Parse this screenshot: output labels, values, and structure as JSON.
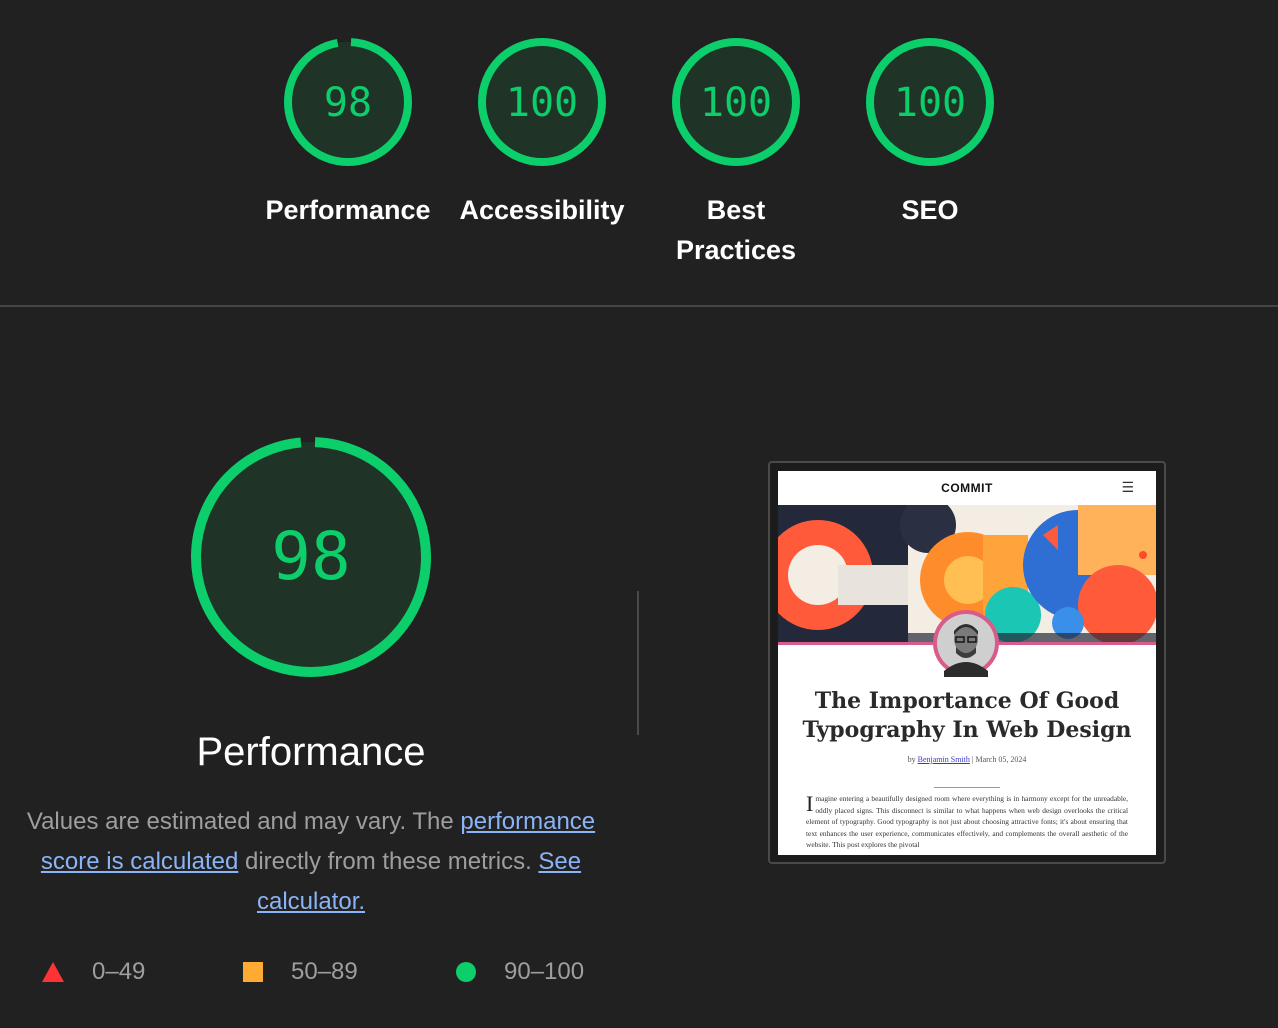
{
  "categories": [
    {
      "score": "98",
      "label": "Performance",
      "value": 0.98
    },
    {
      "score": "100",
      "label": "Accessibility",
      "value": 1.0
    },
    {
      "score": "100",
      "label": "Best Practices",
      "value": 1.0
    },
    {
      "score": "100",
      "label": "SEO",
      "value": 1.0
    }
  ],
  "performance": {
    "score": "98",
    "value": 0.98,
    "title": "Performance",
    "description_1": "Values are estimated and may vary. The ",
    "link_score": "performance score is calculated",
    "description_2": " directly from these metrics. ",
    "link_calculator": "See calculator."
  },
  "legend": {
    "fail": "0–49",
    "average": "50–89",
    "pass": "90–100"
  },
  "screenshot": {
    "logo": "COMMIT",
    "menu_icon": "☰",
    "title": "The Importance Of Good Typography In Web Design",
    "by": "by",
    "author": "Benjamin Smith",
    "date": " | March 05, 2024",
    "dropcap": "I",
    "body": "magine entering a beautifully designed room where everything is in harmony except for the unreadable, oddly placed signs. This disconnect is similar to what happens when web design overlooks the critical element of typography. Good typography is not just about choosing attractive fonts; it's about ensuring that text enhances the user experience, communicates effectively, and complements the overall aesthetic of the website. This post explores the pivotal"
  },
  "colors": {
    "pass": "#0cce6b",
    "average": "#ffaa33",
    "fail": "#ff3333",
    "background": "#212121",
    "link": "#8ab4f8"
  }
}
